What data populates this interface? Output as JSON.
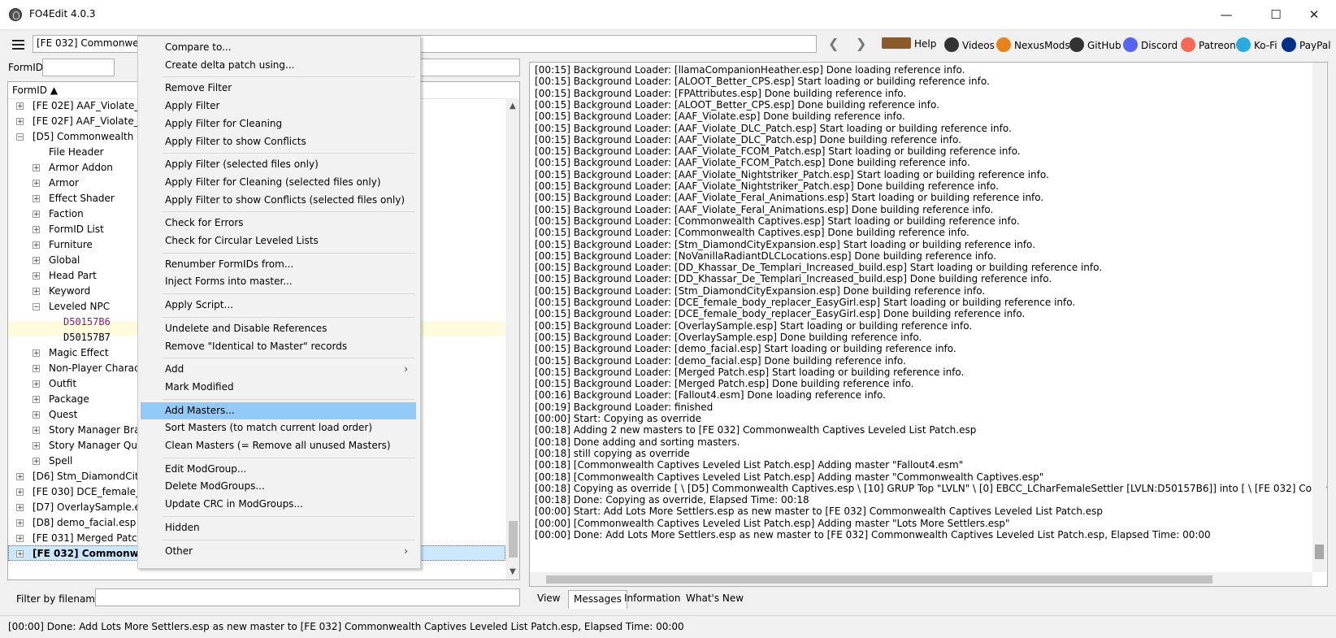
{
  "window": {
    "title": "FO4Edit 4.0.3",
    "controls": [
      "—",
      "☐",
      "✕"
    ]
  },
  "toolbar": {
    "path_value": "[FE 032] Commonwealth Captives Leveled List Patch.esp",
    "nav_back": "❮",
    "nav_forward": "❯",
    "links": [
      {
        "label": "Help",
        "icon": "book-icon",
        "color": "#8b5a2b"
      },
      {
        "label": "Videos",
        "icon": "videos-icon",
        "color": "#333333"
      },
      {
        "label": "NexusMods",
        "icon": "nexusmods-icon",
        "color": "#e8821c"
      },
      {
        "label": "GitHub",
        "icon": "github-icon",
        "color": "#333333"
      },
      {
        "label": "Discord",
        "icon": "discord-icon",
        "color": "#5865f2"
      },
      {
        "label": "Patreon",
        "icon": "patreon-icon",
        "color": "#f96854"
      },
      {
        "label": "Ko-Fi",
        "icon": "kofi-icon",
        "color": "#29abe0"
      },
      {
        "label": "PayPal",
        "icon": "paypal-icon",
        "color": "#003087"
      }
    ]
  },
  "left": {
    "formid_label": "FormID",
    "tree_header": "FormID ▲",
    "filter_label": "Filter by filename:",
    "tree": [
      {
        "label": "[FE 02E] AAF_Violate_Nig",
        "box": "+",
        "level": 0
      },
      {
        "label": "[FE 02F] AAF_Violate_Fer",
        "box": "+",
        "level": 0
      },
      {
        "label": "[D5] Commonwealth Ca",
        "box": "−",
        "level": 0
      },
      {
        "label": "File Header",
        "box": "",
        "level": 1
      },
      {
        "label": "Armor Addon",
        "box": "+",
        "level": 1
      },
      {
        "label": "Armor",
        "box": "+",
        "level": 1
      },
      {
        "label": "Effect Shader",
        "box": "+",
        "level": 1
      },
      {
        "label": "Faction",
        "box": "+",
        "level": 1
      },
      {
        "label": "FormID List",
        "box": "+",
        "level": 1
      },
      {
        "label": "Furniture",
        "box": "+",
        "level": 1
      },
      {
        "label": "Global",
        "box": "+",
        "level": 1
      },
      {
        "label": "Head Part",
        "box": "+",
        "level": 1
      },
      {
        "label": "Keyword",
        "box": "+",
        "level": 1
      },
      {
        "label": "Leveled NPC",
        "box": "−",
        "level": 1
      },
      {
        "label": "D50157B6",
        "box": "",
        "level": 2,
        "mono": true,
        "color": "#7a1f7a"
      },
      {
        "label": "D50157B7",
        "box": "",
        "level": 2,
        "mono": true
      },
      {
        "label": "Magic Effect",
        "box": "+",
        "level": 1
      },
      {
        "label": "Non-Player Characte",
        "box": "+",
        "level": 1
      },
      {
        "label": "Outfit",
        "box": "+",
        "level": 1
      },
      {
        "label": "Package",
        "box": "+",
        "level": 1
      },
      {
        "label": "Quest",
        "box": "+",
        "level": 1
      },
      {
        "label": "Story Manager Branc",
        "box": "+",
        "level": 1
      },
      {
        "label": "Story Manager Quest",
        "box": "+",
        "level": 1
      },
      {
        "label": "Spell",
        "box": "+",
        "level": 1
      },
      {
        "label": "[D6] Stm_DiamondCityE",
        "box": "+",
        "level": 0
      },
      {
        "label": "[FE 030] DCE_female_bod",
        "box": "+",
        "level": 0
      },
      {
        "label": "[D7] OverlaySample.esp",
        "box": "+",
        "level": 0
      },
      {
        "label": "[D8] demo_facial.esp",
        "box": "+",
        "level": 0
      },
      {
        "label": "[FE 031] Merged Patch.e",
        "box": "+",
        "level": 0
      },
      {
        "label": "[FE 032] Commonwealth Captives Leveled List Patch.esp",
        "box": "+",
        "level": 0,
        "bold": true
      }
    ]
  },
  "context_menu": [
    {
      "label": "Compare to..."
    },
    {
      "label": "Create delta patch using..."
    },
    {
      "sep": true
    },
    {
      "label": "Remove Filter"
    },
    {
      "label": "Apply Filter"
    },
    {
      "label": "Apply Filter for Cleaning"
    },
    {
      "label": "Apply Filter to show Conflicts"
    },
    {
      "sep": true
    },
    {
      "label": "Apply Filter (selected files only)"
    },
    {
      "label": "Apply Filter for Cleaning (selected files only)"
    },
    {
      "label": "Apply Filter to show Conflicts (selected files only)"
    },
    {
      "sep": true
    },
    {
      "label": "Check for Errors"
    },
    {
      "label": "Check for Circular Leveled Lists"
    },
    {
      "sep": true
    },
    {
      "label": "Renumber FormIDs from..."
    },
    {
      "label": "Inject Forms into master..."
    },
    {
      "sep": true
    },
    {
      "label": "Apply Script..."
    },
    {
      "sep": true
    },
    {
      "label": "Undelete and Disable References"
    },
    {
      "label": "Remove \"Identical to Master\" records"
    },
    {
      "sep": true
    },
    {
      "label": "Add",
      "submenu": true
    },
    {
      "label": "Mark Modified"
    },
    {
      "sep": true
    },
    {
      "label": "Add Masters...",
      "highlight": true
    },
    {
      "label": "Sort Masters (to match current load order)"
    },
    {
      "label": "Clean Masters (= Remove all unused Masters)"
    },
    {
      "sep": true
    },
    {
      "label": "Edit ModGroup..."
    },
    {
      "label": "Delete ModGroups..."
    },
    {
      "label": "Update CRC in ModGroups..."
    },
    {
      "sep": true
    },
    {
      "label": "Hidden"
    },
    {
      "sep": true
    },
    {
      "label": "Other",
      "submenu": true
    }
  ],
  "log": [
    "[00:15] Background Loader: [llamaCompanionHeather.esp] Done loading reference info.",
    "[00:15] Background Loader: [ALOOT_Better_CPS.esp] Start loading or building reference info.",
    "[00:15] Background Loader: [FPAttributes.esp] Done building reference info.",
    "[00:15] Background Loader: [ALOOT_Better_CPS.esp] Done building reference info.",
    "[00:15] Background Loader: [AAF_Violate.esp] Done building reference info.",
    "[00:15] Background Loader: [AAF_Violate_DLC_Patch.esp] Start loading or building reference info.",
    "[00:15] Background Loader: [AAF_Violate_DLC_Patch.esp] Done building reference info.",
    "[00:15] Background Loader: [AAF_Violate_FCOM_Patch.esp] Start loading or building reference info.",
    "[00:15] Background Loader: [AAF_Violate_FCOM_Patch.esp] Done building reference info.",
    "[00:15] Background Loader: [AAF_Violate_Nightstriker_Patch.esp] Start loading or building reference info.",
    "[00:15] Background Loader: [AAF_Violate_Nightstriker_Patch.esp] Done building reference info.",
    "[00:15] Background Loader: [AAF_Violate_Feral_Animations.esp] Start loading or building reference info.",
    "[00:15] Background Loader: [AAF_Violate_Feral_Animations.esp] Done building reference info.",
    "[00:15] Background Loader: [Commonwealth Captives.esp] Start loading or building reference info.",
    "[00:15] Background Loader: [Commonwealth Captives.esp] Done building reference info.",
    "[00:15] Background Loader: [Stm_DiamondCityExpansion.esp] Start loading or building reference info.",
    "[00:15] Background Loader: [NoVanillaRadiantDLCLocations.esp] Done building reference info.",
    "[00:15] Background Loader: [DD_Khassar_De_Templari_Increased_build.esp] Start loading or building reference info.",
    "[00:15] Background Loader: [DD_Khassar_De_Templari_Increased_build.esp] Done building reference info.",
    "[00:15] Background Loader: [Stm_DiamondCityExpansion.esp] Done building reference info.",
    "[00:15] Background Loader: [DCE_female_body_replacer_EasyGirl.esp] Start loading or building reference info.",
    "[00:15] Background Loader: [DCE_female_body_replacer_EasyGirl.esp] Done building reference info.",
    "[00:15] Background Loader: [OverlaySample.esp] Start loading or building reference info.",
    "[00:15] Background Loader: [OverlaySample.esp] Done building reference info.",
    "[00:15] Background Loader: [demo_facial.esp] Start loading or building reference info.",
    "[00:15] Background Loader: [demo_facial.esp] Done building reference info.",
    "[00:15] Background Loader: [Merged Patch.esp] Start loading or building reference info.",
    "[00:15] Background Loader: [Merged Patch.esp] Done building reference info.",
    "[00:16] Background Loader: [Fallout4.esm] Done loading reference info.",
    "[00:19] Background Loader: finished",
    "[00:00] Start: Copying as override",
    "[00:18] Adding 2 new masters to [FE 032] Commonwealth Captives Leveled List Patch.esp",
    "[00:18] Done adding and sorting masters.",
    "[00:18] still copying as override",
    "[00:18] [Commonwealth Captives Leveled List Patch.esp] Adding master \"Fallout4.esm\"",
    "[00:18] [Commonwealth Captives Leveled List Patch.esp] Adding master \"Commonwealth Captives.esp\"",
    "[00:18] Copying as override [ \\ [D5] Commonwealth Captives.esp \\ [10] GRUP Top \"LVLN\" \\ [0] EBCC_LCharFemaleSettler [LVLN:D50157B6]] into [ \\ [FE 032] Commonwealth Captives",
    "[00:18] Done: Copying as override, Elapsed Time: 00:18",
    "[00:00] Start: Add Lots More Settlers.esp as new master to [FE 032] Commonwealth Captives Leveled List Patch.esp",
    "[00:00] [Commonwealth Captives Leveled List Patch.esp] Adding master \"Lots More Settlers.esp\"",
    "[00:00] Done: Add Lots More Settlers.esp as new master to [FE 032] Commonwealth Captives Leveled List Patch.esp, Elapsed Time: 00:00"
  ],
  "tabs": [
    "View",
    "Messages",
    "Information",
    "What's New"
  ],
  "active_tab": "Messages",
  "status": "[00:00] Done: Add Lots More Settlers.esp as new master to [FE 032] Commonwealth Captives Leveled List Patch.esp, Elapsed Time: 00:00"
}
